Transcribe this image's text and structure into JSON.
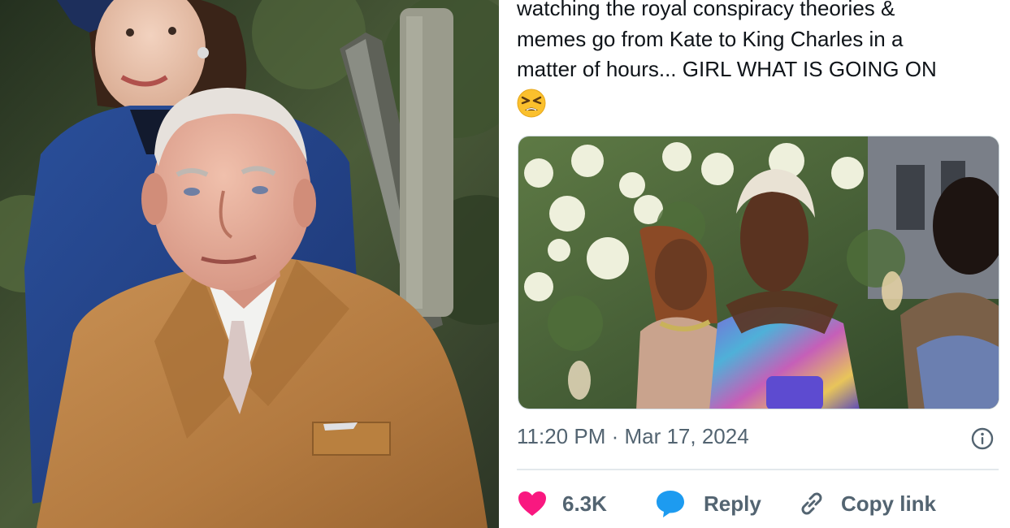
{
  "photo": {
    "alt": "King Charles and Kate photo"
  },
  "tweet": {
    "text_lines": [
      "watching the royal conspiracy theories &",
      "memes go from Kate to King Charles in a",
      "matter of hours... GIRL WHAT IS GOING ON"
    ],
    "emoji": "tired-face-emoji",
    "timestamp": "11:20 PM · Mar 17, 2024",
    "actions": {
      "like_count": "6.3K",
      "reply_label": "Reply",
      "copy_link_label": "Copy link"
    }
  },
  "colors": {
    "like": "#f91880",
    "reply": "#1d9bf0",
    "meta": "#536471",
    "text": "#0f1419"
  },
  "icons": [
    "heart-icon",
    "speech-bubble-icon",
    "link-icon",
    "info-icon"
  ]
}
